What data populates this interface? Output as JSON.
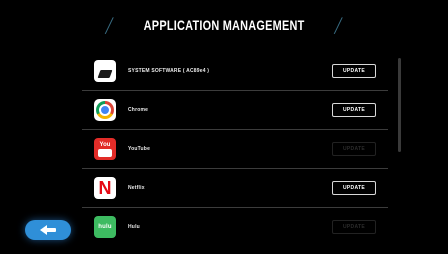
{
  "header": {
    "title": "APPLICATION MANAGEMENT"
  },
  "apps": [
    {
      "name": "SYSTEM SOFTWARE ( AC89e4 )",
      "icon": "system-software-icon",
      "update_label": "UPDATE",
      "update_enabled": true
    },
    {
      "name": "Chrome",
      "icon": "chrome-icon",
      "update_label": "UPDATE",
      "update_enabled": true
    },
    {
      "name": "YouTube",
      "icon": "youtube-icon",
      "icon_text": "You",
      "update_label": "UPDATE",
      "update_enabled": false
    },
    {
      "name": "Netflix",
      "icon": "netflix-icon",
      "icon_text": "N",
      "update_label": "UPDATE",
      "update_enabled": true
    },
    {
      "name": "Hulu",
      "icon": "hulu-icon",
      "icon_text": "hulu",
      "update_label": "UPDATE",
      "update_enabled": false
    }
  ],
  "colors": {
    "accent": "#2f8fd8",
    "title_slash": "#3a6f86",
    "background": "#000000"
  },
  "navigation": {
    "back_icon": "back-arrow-icon"
  }
}
